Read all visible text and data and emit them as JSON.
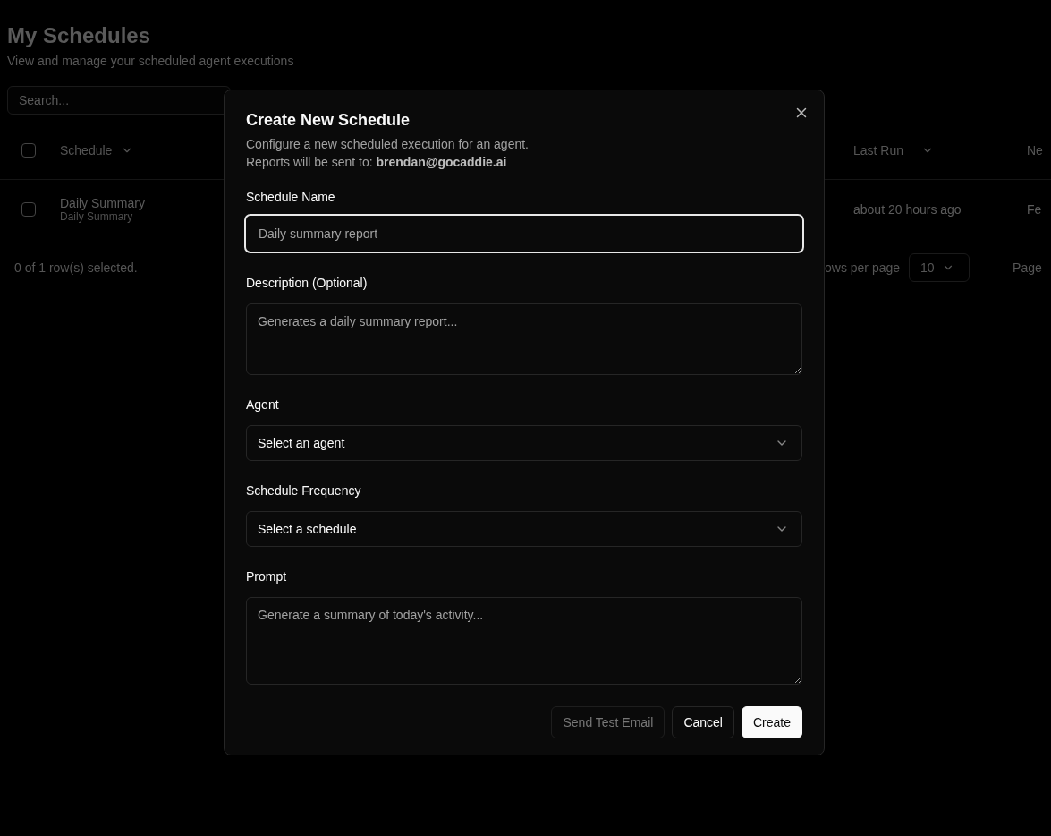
{
  "page": {
    "title": "My Schedules",
    "subtitle": "View and manage your scheduled agent executions",
    "search": {
      "placeholder": "Search..."
    },
    "table": {
      "header_checked": false,
      "columns": [
        {
          "label": "Schedule"
        },
        {
          "label": "Last Run"
        },
        {
          "label": "Ne"
        }
      ],
      "rows": [
        {
          "name": "Daily Summary",
          "description": "Daily Summary",
          "last_run": "about 20 hours ago",
          "column_3": "Fe",
          "selected": false
        }
      ]
    },
    "footer": {
      "selection": "0 of 1 row(s) selected.",
      "rows_per_page_label": "ows per page",
      "rows_per_page": "10",
      "page_label": "Page"
    }
  },
  "dialog": {
    "title": "Create New Schedule",
    "description": [
      "Configure a new scheduled execution for an agent.",
      "Reports will be sent to: **brendan@gocaddie.ai**"
    ],
    "fields": [
      {
        "kind": "input",
        "label": "Schedule Name",
        "placeholder": "Daily summary report",
        "focused": true
      },
      {
        "kind": "textarea",
        "label": "Description (Optional)",
        "placeholder": "Generates a daily summary report...",
        "focused": false
      },
      {
        "kind": "select",
        "label": "Agent",
        "value": "Select an agent",
        "focused": false
      },
      {
        "kind": "select",
        "label": "Schedule Frequency",
        "value": "Select a schedule",
        "focused": false
      },
      {
        "kind": "textarea",
        "label": "Prompt",
        "placeholder": "Generate a summary of today's activity...",
        "focused": false,
        "tall": true
      }
    ],
    "buttons": [
      {
        "label": "Send Test Email",
        "kind": "outline",
        "disabled": true
      },
      {
        "label": "Cancel",
        "kind": "outline",
        "disabled": false
      },
      {
        "label": "Create",
        "kind": "primary",
        "disabled": false
      }
    ]
  }
}
